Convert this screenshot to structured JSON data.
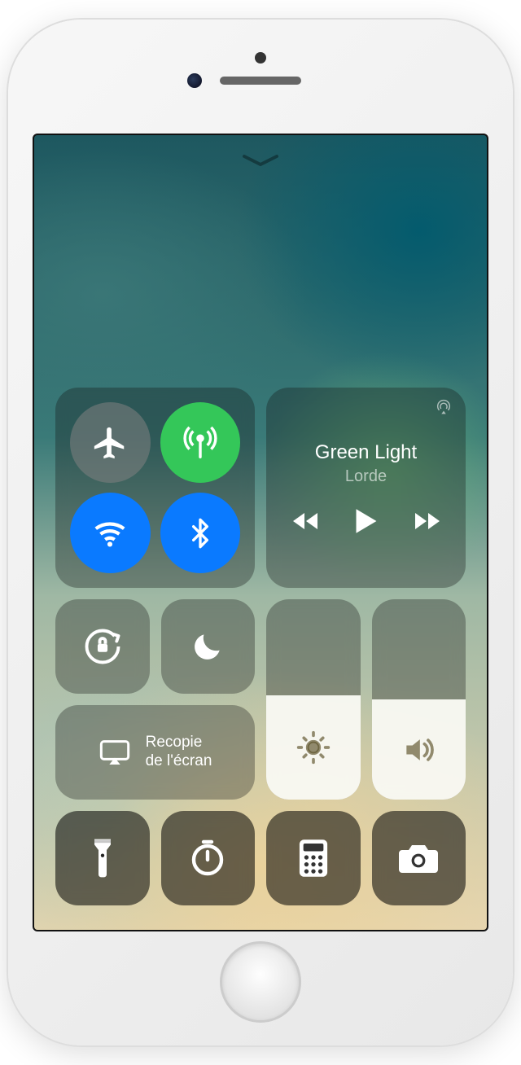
{
  "connectivity": {
    "airplane": {
      "on": false
    },
    "cellular": {
      "on": true
    },
    "wifi": {
      "on": true
    },
    "bluetooth": {
      "on": true
    }
  },
  "music": {
    "title": "Green Light",
    "artist": "Lorde"
  },
  "screen_mirroring": {
    "label": "Recopie\nde l'écran"
  },
  "sliders": {
    "brightness_percent": 52,
    "volume_percent": 50
  },
  "shortcuts": {
    "flashlight": "flashlight",
    "timer": "timer",
    "calculator": "calculator",
    "camera": "camera"
  }
}
